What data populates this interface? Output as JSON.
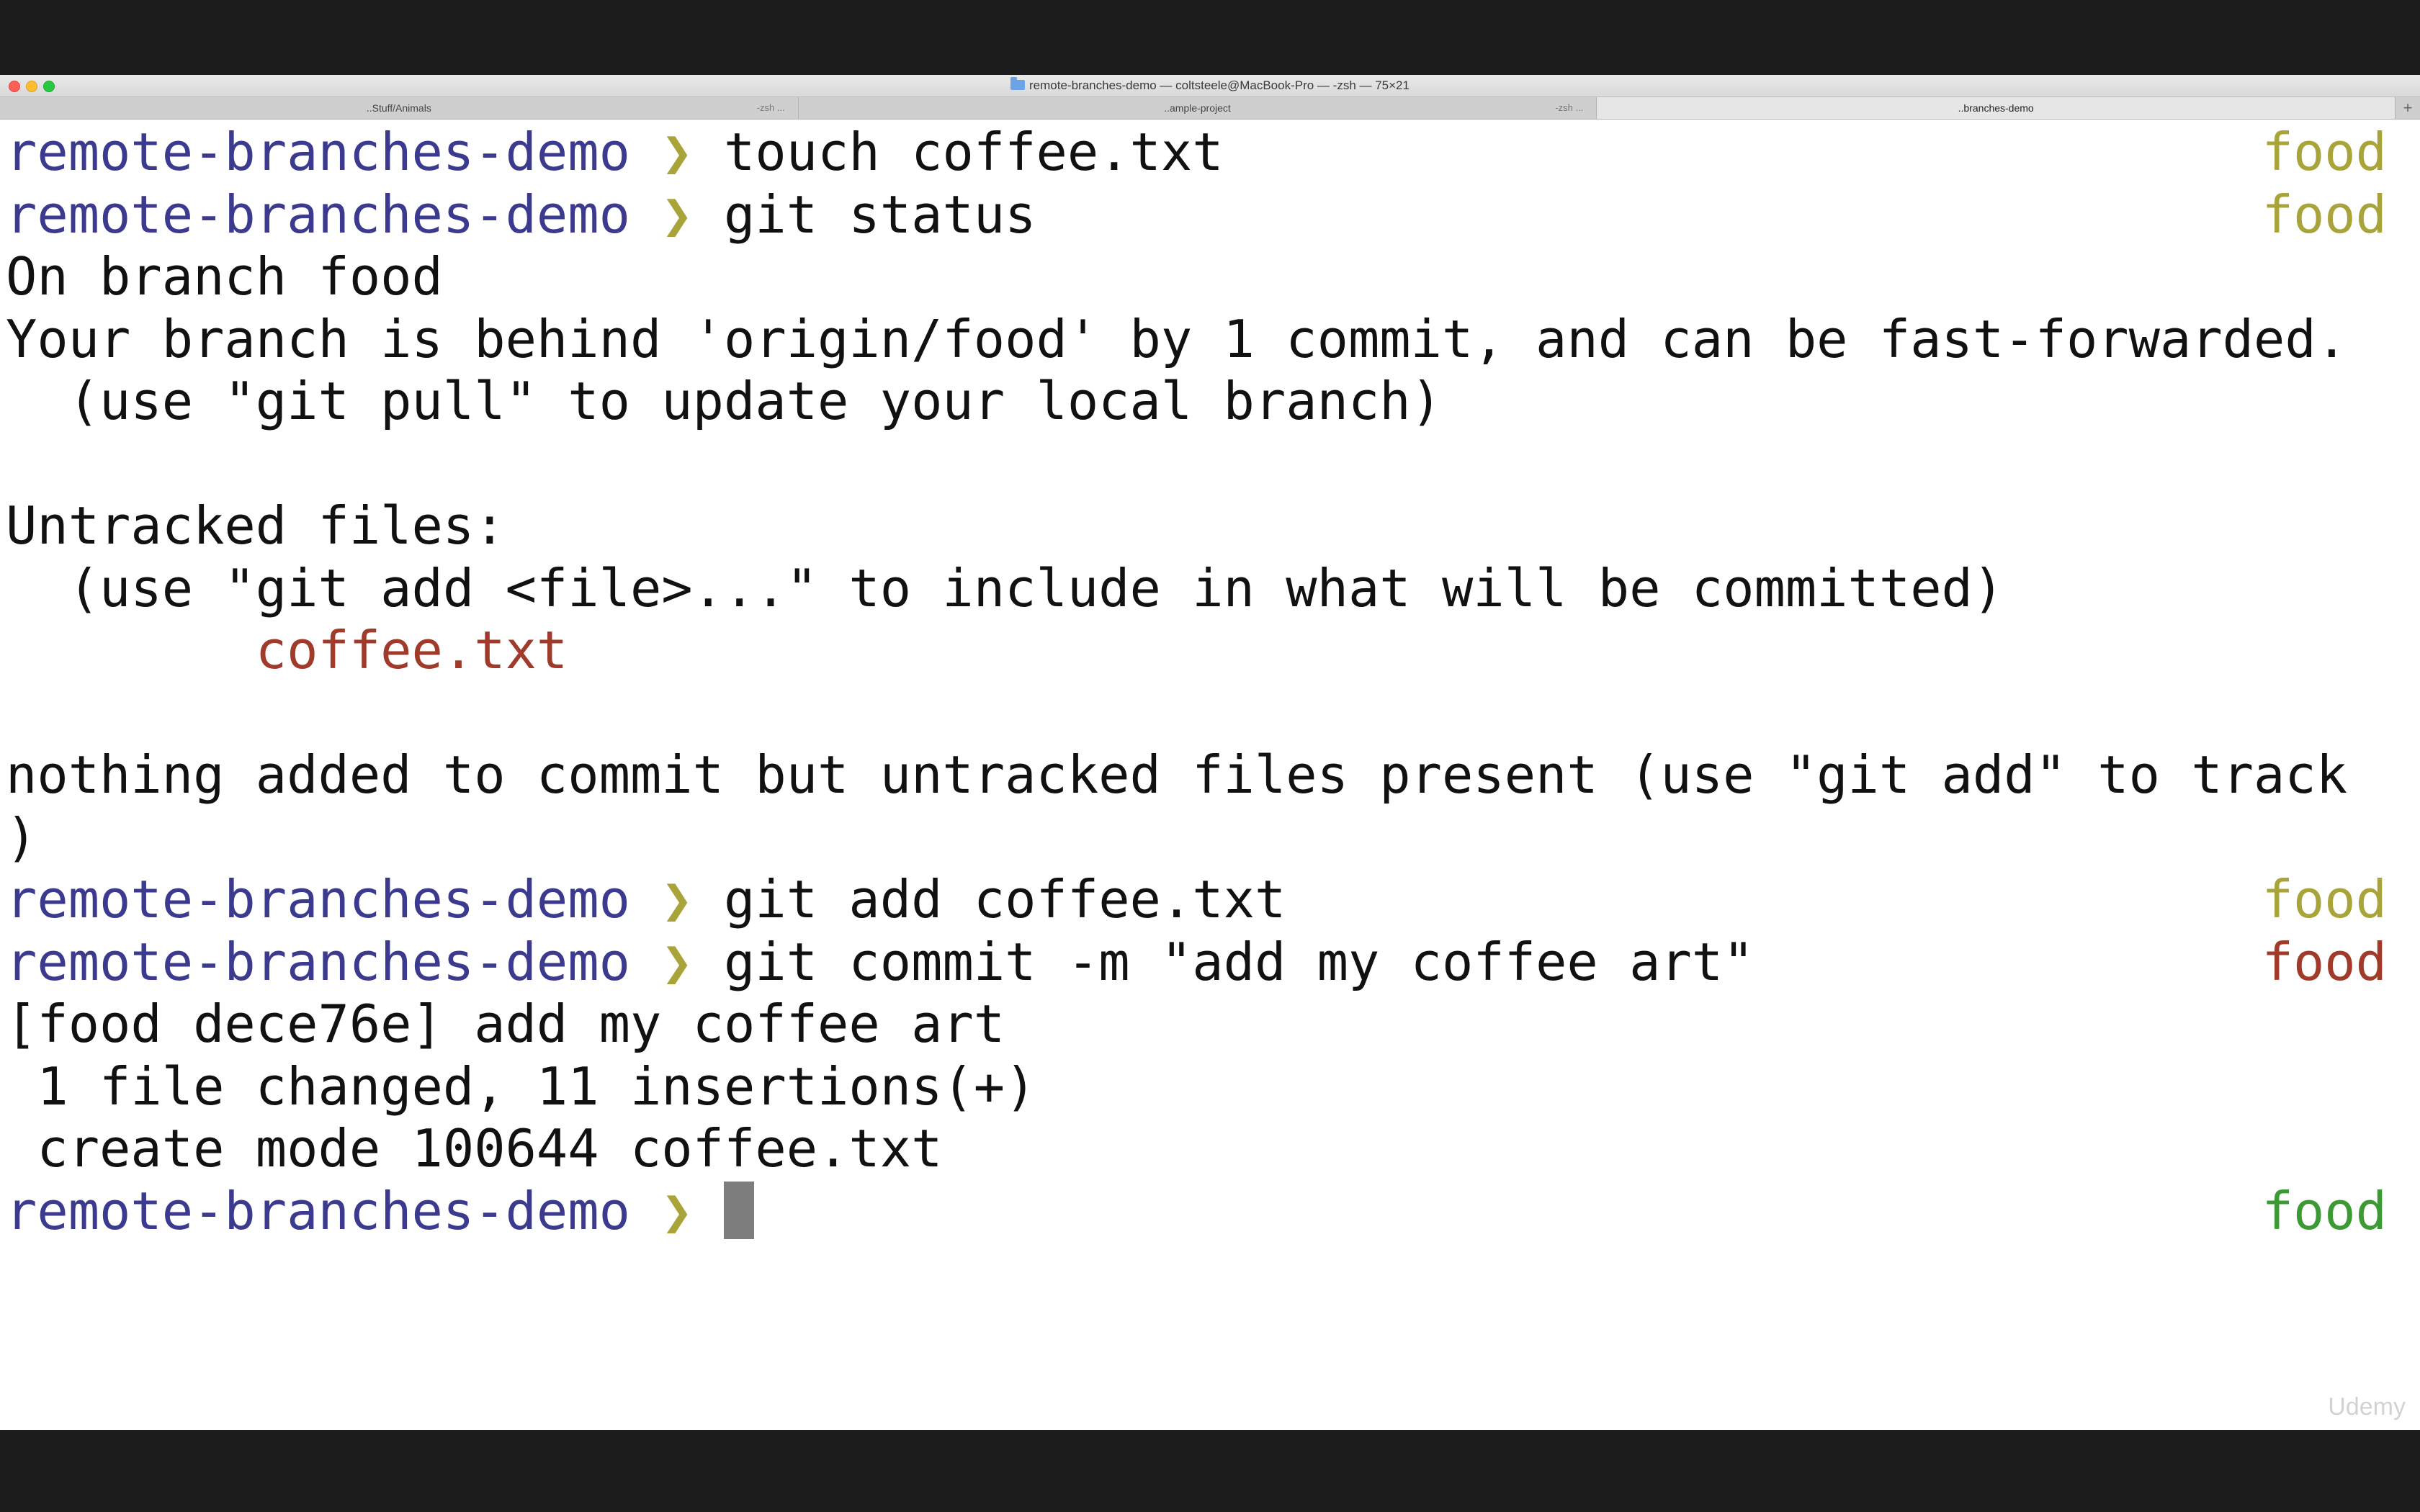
{
  "window": {
    "title": "remote-branches-demo — coltsteele@MacBook-Pro — -zsh — 75×21"
  },
  "tabs": [
    {
      "label": "..Stuff/Animals",
      "sub": "-zsh ..."
    },
    {
      "label": "..ample-project",
      "sub": "-zsh ..."
    },
    {
      "label": "..branches-demo",
      "sub": ""
    }
  ],
  "tab_add_label": "+",
  "prompt": {
    "dir": "remote-branches-demo",
    "chevron": "❯"
  },
  "lines": [
    {
      "kind": "prompt",
      "cmd": "touch coffee.txt",
      "branch": "food",
      "branch_color": "#a8a43a"
    },
    {
      "kind": "prompt",
      "cmd": "git status",
      "branch": "food",
      "branch_color": "#a8a43a"
    },
    {
      "kind": "out",
      "text": "On branch food"
    },
    {
      "kind": "out",
      "text": "Your branch is behind 'origin/food' by 1 commit, and can be fast-forwarded."
    },
    {
      "kind": "out",
      "text": "  (use \"git pull\" to update your local branch)"
    },
    {
      "kind": "out",
      "text": ""
    },
    {
      "kind": "out",
      "text": "Untracked files:"
    },
    {
      "kind": "out",
      "text": "  (use \"git add <file>...\" to include in what will be committed)"
    },
    {
      "kind": "untracked",
      "text": "        coffee.txt"
    },
    {
      "kind": "out",
      "text": ""
    },
    {
      "kind": "out",
      "text": "nothing added to commit but untracked files present (use \"git add\" to track"
    },
    {
      "kind": "out",
      "text": ")"
    },
    {
      "kind": "prompt",
      "cmd": "git add coffee.txt",
      "branch": "food",
      "branch_color": "#a8a43a"
    },
    {
      "kind": "prompt",
      "cmd": "git commit -m \"add my coffee art\"",
      "branch": "food",
      "branch_color": "#a23a2a"
    },
    {
      "kind": "out",
      "text": "[food dece76e] add my coffee art"
    },
    {
      "kind": "out",
      "text": " 1 file changed, 11 insertions(+)"
    },
    {
      "kind": "out",
      "text": " create mode 100644 coffee.txt"
    },
    {
      "kind": "current",
      "cmd": "",
      "branch": "food",
      "branch_color": "#3c9a34"
    }
  ],
  "watermark": "Udemy",
  "colors": {
    "prompt_dir": "#3b3a8f",
    "chevron": "#a8a43a",
    "untracked_file": "#a03a2a"
  }
}
